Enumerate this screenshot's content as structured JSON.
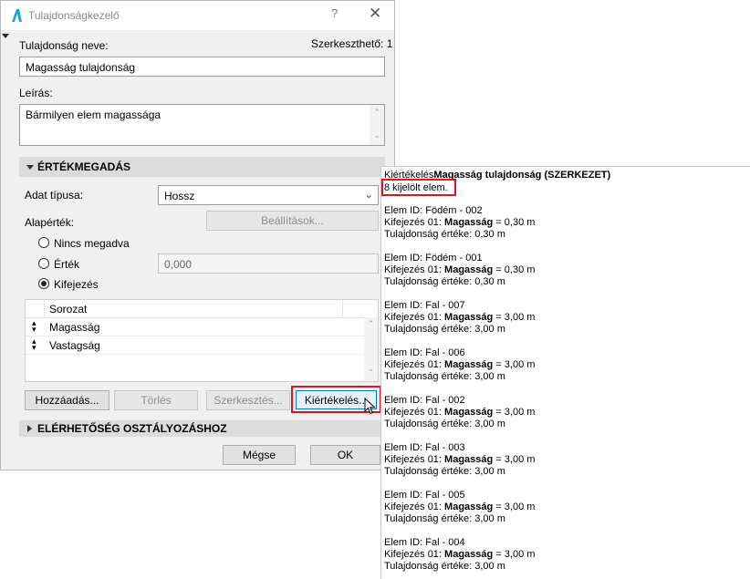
{
  "dialog": {
    "title": "Tulajdonságkezelő",
    "help_label": "?",
    "close_label": "✕",
    "name_label": "Tulajdonság neve:",
    "editable_label": "Szerkeszthető: 1",
    "name_value": "Magasság tulajdonság",
    "desc_label": "Leírás:",
    "desc_value": "Bármilyen elem magassága",
    "section_values": "ÉRTÉKMEGADÁS",
    "data_type_label": "Adat típusa:",
    "data_type_value": "Hossz",
    "default_label": "Alapérték:",
    "settings_button": "Beállítások...",
    "radio_none": "Nincs megadva",
    "radio_value": "Érték",
    "value_field": "0,000",
    "radio_expression": "Kifejezés",
    "table_header": "Sorozat",
    "table_rows": [
      "Magasság",
      "Vastagság"
    ],
    "add_button": "Hozzáadás...",
    "delete_button": "Törlés",
    "edit_button": "Szerkesztés...",
    "evaluate_button": "Kiértékelés...",
    "section_availability": "ELÉRHETŐSÉG OSZTÁLYOZÁSHOZ",
    "cancel_button": "Mégse",
    "ok_button": "OK"
  },
  "result": {
    "title_prefix": "Kiértékelés",
    "title_bold": "Magasság tulajdonság (SZERKEZET)",
    "selected_count": "8 kijelölt elem.",
    "expr_prefix": "Kifejezés 01: ",
    "expr_bold": "Magasság",
    "entries": [
      {
        "id": "Elem ID: Födém - 002",
        "expr_value": " = 0,30 m",
        "value": "Tulajdonság értéke: 0,30 m"
      },
      {
        "id": "Elem ID: Födém - 001",
        "expr_value": " = 0,30 m",
        "value": "Tulajdonság értéke: 0,30 m"
      },
      {
        "id": "Elem ID: Fal - 007",
        "expr_value": " = 3,00 m",
        "value": "Tulajdonság értéke: 3,00 m"
      },
      {
        "id": "Elem ID: Fal - 006",
        "expr_value": " = 3,00 m",
        "value": "Tulajdonság értéke: 3,00 m"
      },
      {
        "id": "Elem ID: Fal - 002",
        "expr_value": " = 3,00 m",
        "value": "Tulajdonság értéke: 3,00 m"
      },
      {
        "id": "Elem ID: Fal - 003",
        "expr_value": " = 3,00 m",
        "value": "Tulajdonság értéke: 3,00 m"
      },
      {
        "id": "Elem ID: Fal - 005",
        "expr_value": " = 3,00 m",
        "value": "Tulajdonság értéke: 3,00 m"
      },
      {
        "id": "Elem ID: Fal - 004",
        "expr_value": " = 3,00 m",
        "value": "Tulajdonság értéke: 3,00 m"
      }
    ]
  },
  "colors": {
    "highlight": "#e0141c",
    "app_icon": "#1fa3e0"
  },
  "icons": [
    "archicad-logo-icon",
    "help-icon",
    "close-icon",
    "dropdown-arrow-icon",
    "sort-arrows-icon",
    "mouse-cursor-icon"
  ]
}
